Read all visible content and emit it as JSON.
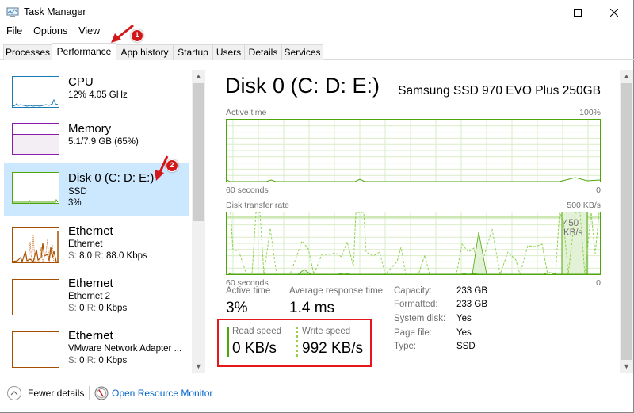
{
  "window": {
    "title": "Task Manager",
    "controls": {
      "minimize": "minimize",
      "maximize": "maximize",
      "close": "close"
    }
  },
  "menu": [
    "File",
    "Options",
    "View"
  ],
  "tabs": [
    {
      "label": "Processes",
      "active": false
    },
    {
      "label": "Performance",
      "active": true
    },
    {
      "label": "App history",
      "active": false
    },
    {
      "label": "Startup",
      "active": false
    },
    {
      "label": "Users",
      "active": false
    },
    {
      "label": "Details",
      "active": false
    },
    {
      "label": "Services",
      "active": false
    }
  ],
  "sidebar": {
    "items": [
      {
        "title": "CPU",
        "line1": "12% 4.05 GHz",
        "line2": "",
        "color": "#1979b5",
        "selected": false
      },
      {
        "title": "Memory",
        "line1": "5.1/7.9 GB (65%)",
        "line2": "",
        "color": "#8b1bab",
        "selected": false,
        "fill_percent": 65
      },
      {
        "title": "Disk 0 (C: D: E:)",
        "line1": "SSD",
        "line2": "3%",
        "color": "#4da60c",
        "selected": true
      },
      {
        "title": "Ethernet",
        "line1": "Ethernet",
        "line2_s_label": "S:",
        "line2_s": "8.0",
        "line2_r_label": "R:",
        "line2_r": "88.0 Kbps",
        "color": "#a74f01",
        "selected": false
      },
      {
        "title": "Ethernet",
        "line1": "Ethernet 2",
        "line2_s_label": "S:",
        "line2_s": "0",
        "line2_r_label": "R:",
        "line2_r": "0 Kbps",
        "color": "#a74f01",
        "selected": false
      },
      {
        "title": "Ethernet",
        "line1": "VMware Network Adapter ...",
        "line2_s_label": "S:",
        "line2_s": "0",
        "line2_r_label": "R:",
        "line2_r": "0 Kbps",
        "color": "#a74f01",
        "selected": false
      }
    ]
  },
  "detail": {
    "title": "Disk 0 (C: D: E:)",
    "model": "Samsung SSD 970 EVO Plus 250GB",
    "active_time_graph": {
      "label": "Active time",
      "max_label": "100%",
      "x_left": "60 seconds",
      "x_right": "0"
    },
    "transfer_graph": {
      "label": "Disk transfer rate",
      "max_label": "500 KB/s",
      "marker_label": "450 KB/s",
      "x_left": "60 seconds",
      "x_right": "0"
    },
    "stats": {
      "active_time_label": "Active time",
      "active_time_value": "3%",
      "avg_response_label": "Average response time",
      "avg_response_value": "1.4 ms",
      "read_label": "Read speed",
      "read_value": "0 KB/s",
      "write_label": "Write speed",
      "write_value": "992 KB/s"
    },
    "properties": [
      {
        "label": "Capacity:",
        "value": "233 GB"
      },
      {
        "label": "Formatted:",
        "value": "233 GB"
      },
      {
        "label": "System disk:",
        "value": "Yes"
      },
      {
        "label": "Page file:",
        "value": "Yes"
      },
      {
        "label": "Type:",
        "value": "SSD"
      }
    ]
  },
  "footer": {
    "fewer_details": "Fewer details",
    "open_resource_monitor": "Open Resource Monitor"
  },
  "annotations": [
    {
      "number": "1",
      "target": "Performance tab"
    },
    {
      "number": "2",
      "target": "Disk 0 sidebar item"
    }
  ],
  "colors": {
    "disk_green": "#4da60c",
    "write_dash_green": "#8fd14f",
    "grid_green": "#d9ecc8",
    "selected_bg": "#cce8ff",
    "link_blue": "#0066cc",
    "annotation_red": "#e5171c"
  }
}
